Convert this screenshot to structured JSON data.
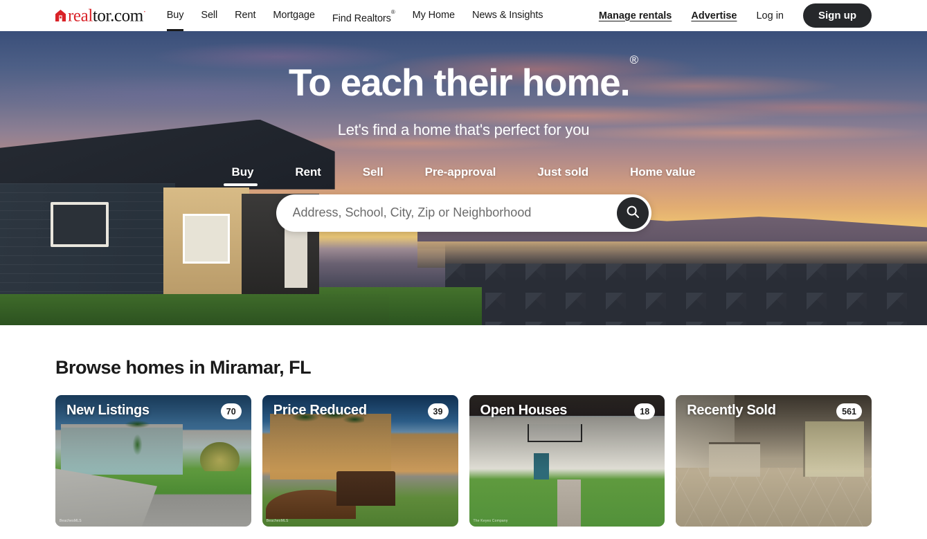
{
  "header": {
    "logo": {
      "brand_red": "real",
      "brand_black": "tor.com",
      "house_icon": "house-icon",
      "accent_color": "#d92228"
    },
    "nav": [
      {
        "label": "Buy",
        "active": true
      },
      {
        "label": "Sell",
        "active": false
      },
      {
        "label": "Rent",
        "active": false
      },
      {
        "label": "Mortgage",
        "active": false
      },
      {
        "label": "Find Realtors",
        "sup": "®",
        "active": false
      },
      {
        "label": "My Home",
        "active": false
      },
      {
        "label": "News & Insights",
        "active": false
      }
    ],
    "manage_rentals": "Manage rentals",
    "advertise": "Advertise",
    "log_in": "Log in",
    "sign_up": "Sign up"
  },
  "hero": {
    "title": "To each their home.",
    "title_mark": "®",
    "subtitle": "Let's find a home that's perfect for you",
    "tabs": [
      {
        "label": "Buy",
        "active": true
      },
      {
        "label": "Rent",
        "active": false
      },
      {
        "label": "Sell",
        "active": false
      },
      {
        "label": "Pre-approval",
        "active": false
      },
      {
        "label": "Just sold",
        "active": false
      },
      {
        "label": "Home value",
        "active": false
      }
    ],
    "search": {
      "placeholder": "Address, School, City, Zip or Neighborhood",
      "value": "",
      "button_icon": "search-icon"
    }
  },
  "browse": {
    "title": "Browse homes in Miramar, FL",
    "cards": [
      {
        "label": "New Listings",
        "count": "70",
        "attribution": "BeachesMLS"
      },
      {
        "label": "Price Reduced",
        "count": "39",
        "attribution": "BeachesMLS"
      },
      {
        "label": "Open Houses",
        "count": "18",
        "attribution": "The Keyes Company"
      },
      {
        "label": "Recently Sold",
        "count": "561",
        "attribution": ""
      }
    ]
  }
}
